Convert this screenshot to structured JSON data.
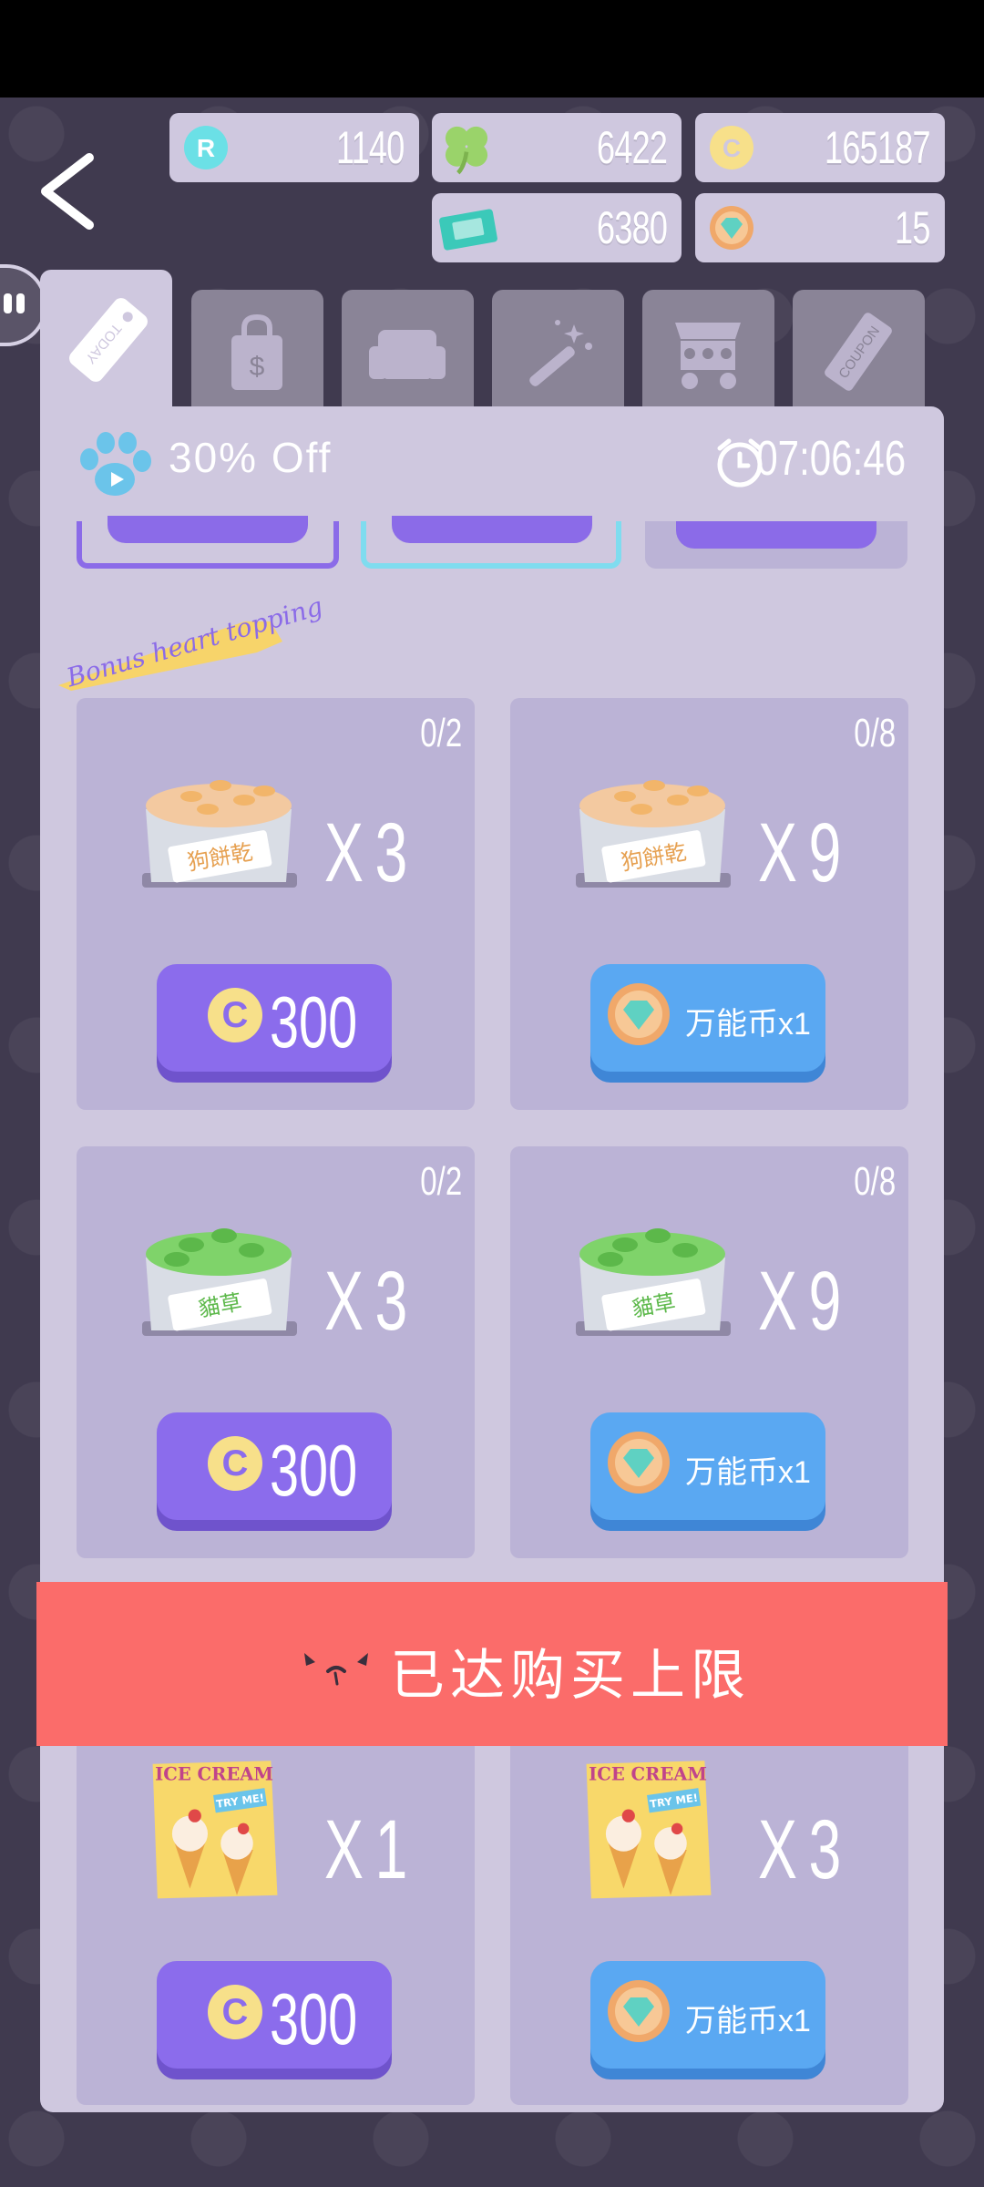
{
  "resources": [
    {
      "name": "r-points",
      "icon": "r-badge-icon",
      "value": "1140",
      "color": "#6be0e6"
    },
    {
      "name": "clover",
      "icon": "clover-icon",
      "value": "6422",
      "color": "#9ad36a"
    },
    {
      "name": "coins",
      "icon": "coin-icon",
      "value": "165187",
      "color": "#f7e08a"
    },
    {
      "name": "tickets",
      "icon": "ticket-icon",
      "value": "6380",
      "color": "#3bc9b9"
    },
    {
      "name": "gems",
      "icon": "gem-icon",
      "value": "15",
      "color": "#f0a86a"
    }
  ],
  "tabs": [
    {
      "name": "tab-today",
      "icon": "today-tag-icon",
      "label": "TODAY",
      "active": true
    },
    {
      "name": "tab-shop",
      "icon": "shopping-bag-icon",
      "label": "$"
    },
    {
      "name": "tab-furniture",
      "icon": "sofa-icon"
    },
    {
      "name": "tab-magic",
      "icon": "magic-wand-icon"
    },
    {
      "name": "tab-cart",
      "icon": "food-cart-icon"
    },
    {
      "name": "tab-coupon",
      "icon": "coupon-icon",
      "label": "COUPON"
    }
  ],
  "header": {
    "discount": "30% Off",
    "timer": "07:06:46"
  },
  "ribbon": "Bonus heart topping",
  "cards": [
    {
      "item": "dog-biscuit-box",
      "label": "狗餅乾",
      "qty": "X3",
      "limit": "0/2",
      "price_type": "coin",
      "price": "300"
    },
    {
      "item": "dog-biscuit-box",
      "label": "狗餅乾",
      "qty": "X9",
      "limit": "0/8",
      "price_type": "gem",
      "price": "万能币x1"
    },
    {
      "item": "catnip-box",
      "label": "貓草",
      "qty": "X3",
      "limit": "0/2",
      "price_type": "coin",
      "price": "300"
    },
    {
      "item": "catnip-box",
      "label": "貓草",
      "qty": "X9",
      "limit": "0/8",
      "price_type": "gem",
      "price": "万能币x1"
    },
    {
      "item": "ice-cream-poster",
      "label": "ICE CREAM",
      "sub": "TRY ME!",
      "qty": "X1",
      "price_type": "coin",
      "price": "300"
    },
    {
      "item": "ice-cream-poster",
      "label": "ICE CREAM",
      "sub": "TRY ME!",
      "qty": "X3",
      "price_type": "gem",
      "price": "万能币x1"
    }
  ],
  "toast": {
    "message": "已达购买上限",
    "color": "#fb6c6a"
  },
  "coin_symbol": "C"
}
